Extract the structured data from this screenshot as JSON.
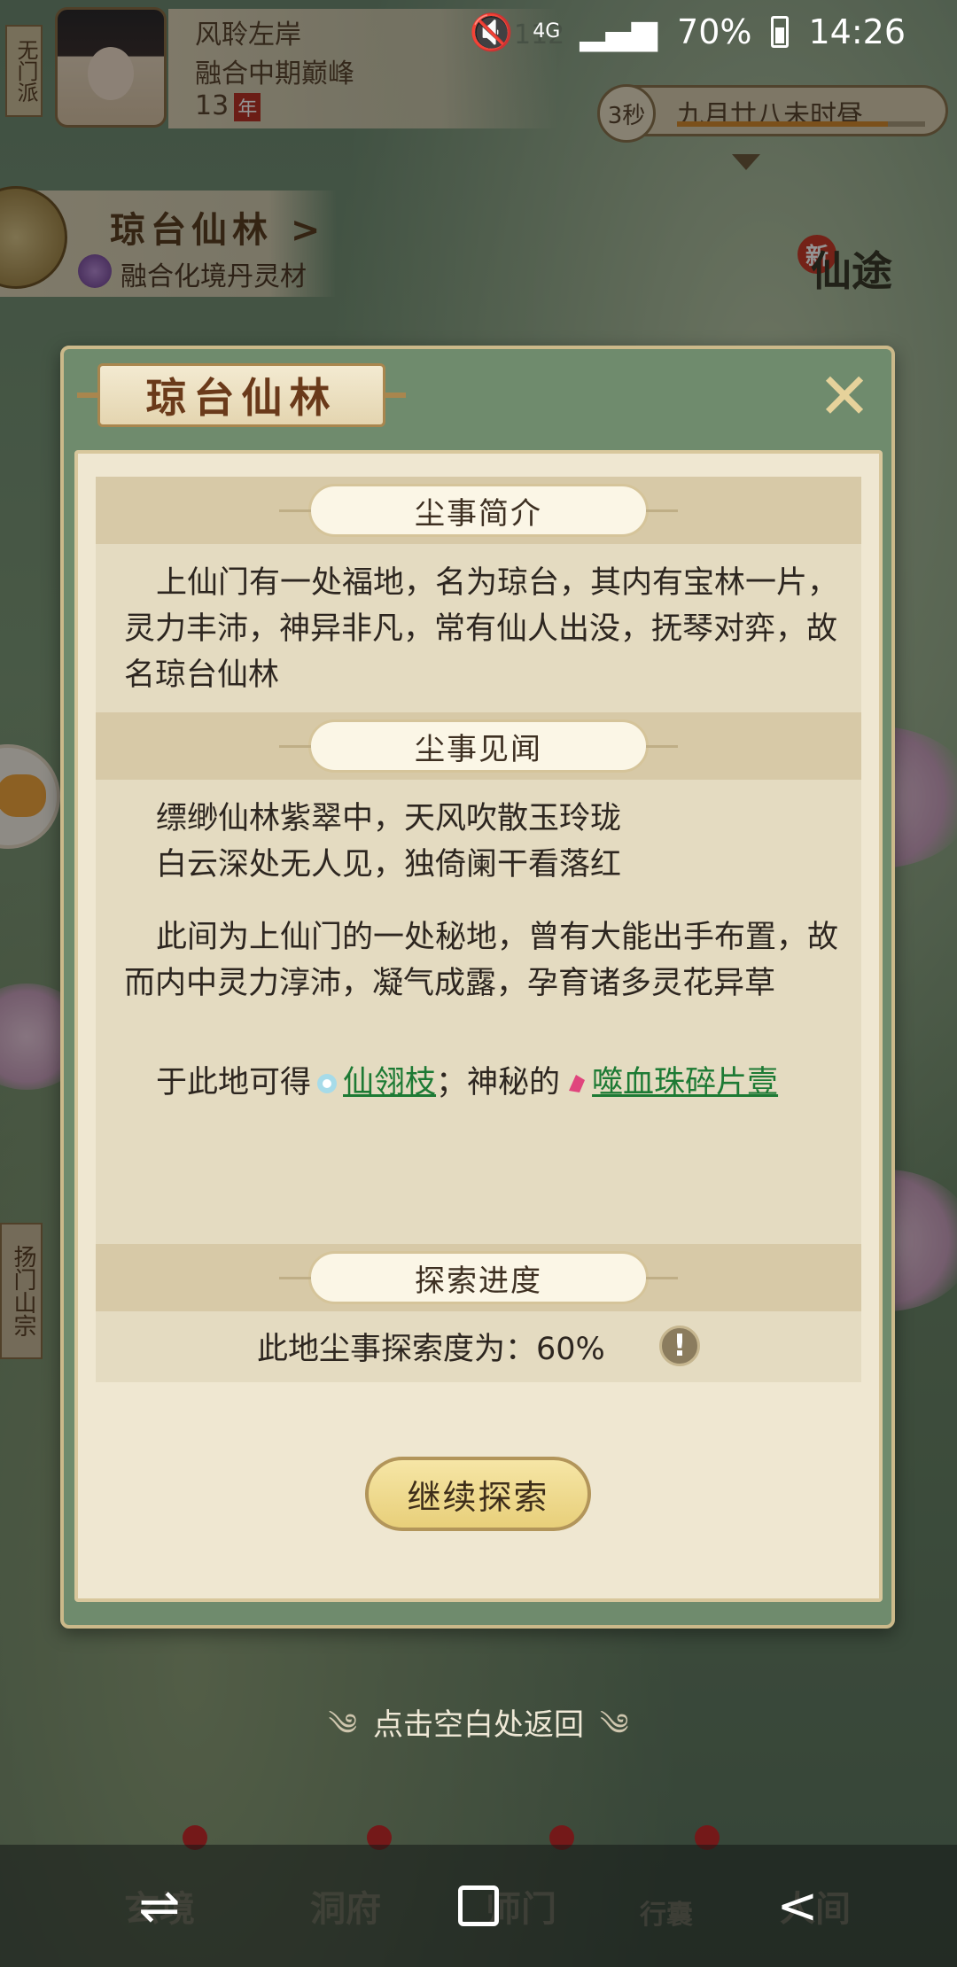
{
  "status_bar": {
    "network": "4G",
    "battery": "70%",
    "time": "14:26"
  },
  "hud": {
    "sect_tag": "无门派",
    "player_name": "风聆左岸",
    "realm": "融合中期巅峰",
    "age_value": "13",
    "age_unit": "年",
    "count": "112",
    "timer_seconds": "3秒",
    "date_text": "九月廿八未时昼",
    "timer_progress": 0.85,
    "location_title": "琼台仙林 >",
    "location_material": "融合化境丹灵材",
    "new_badge": "新",
    "xiantu_label": "仙途",
    "side_sect": "扬门山宗"
  },
  "modal": {
    "title": "琼台仙林",
    "close_icon": "close-x-icon",
    "sections": {
      "intro_header": "尘事简介",
      "intro_text": "上仙门有一处福地，名为琼台，其内有宝林一片，灵力丰沛，神异非凡，常有仙人出没，抚琴对弈，故名琼台仙林",
      "lore_header": "尘事见闻",
      "poem_line1": "缥缈仙林紫翠中，天风吹散玉玲珑",
      "poem_line2": "白云深处无人见，独倚阑干看落红",
      "lore_paragraph": "此间为上仙门的一处秘地，曾有大能出手布置，故而内中灵力淳沛，凝气成露，孕育诸多灵花异草",
      "loot_prefix": "于此地可得",
      "loot_item1": "仙翎枝",
      "loot_sep": "；神秘的",
      "loot_item2": "噬血珠碎片壹",
      "progress_header": "探索进度",
      "progress_text": "此地尘事探索度为：60%",
      "progress_value": 60
    },
    "continue_button": "继续探索"
  },
  "tap_return": "点击空白处返回",
  "game_nav": {
    "tab1": "玄境",
    "tab2": "洞府",
    "tab3": "师门",
    "tab4": "行囊",
    "tab5": "人间"
  },
  "colors": {
    "link_green": "#1d7a34",
    "accent_gold": "#e8cf7a",
    "frame_green": "#6f8b6d"
  }
}
